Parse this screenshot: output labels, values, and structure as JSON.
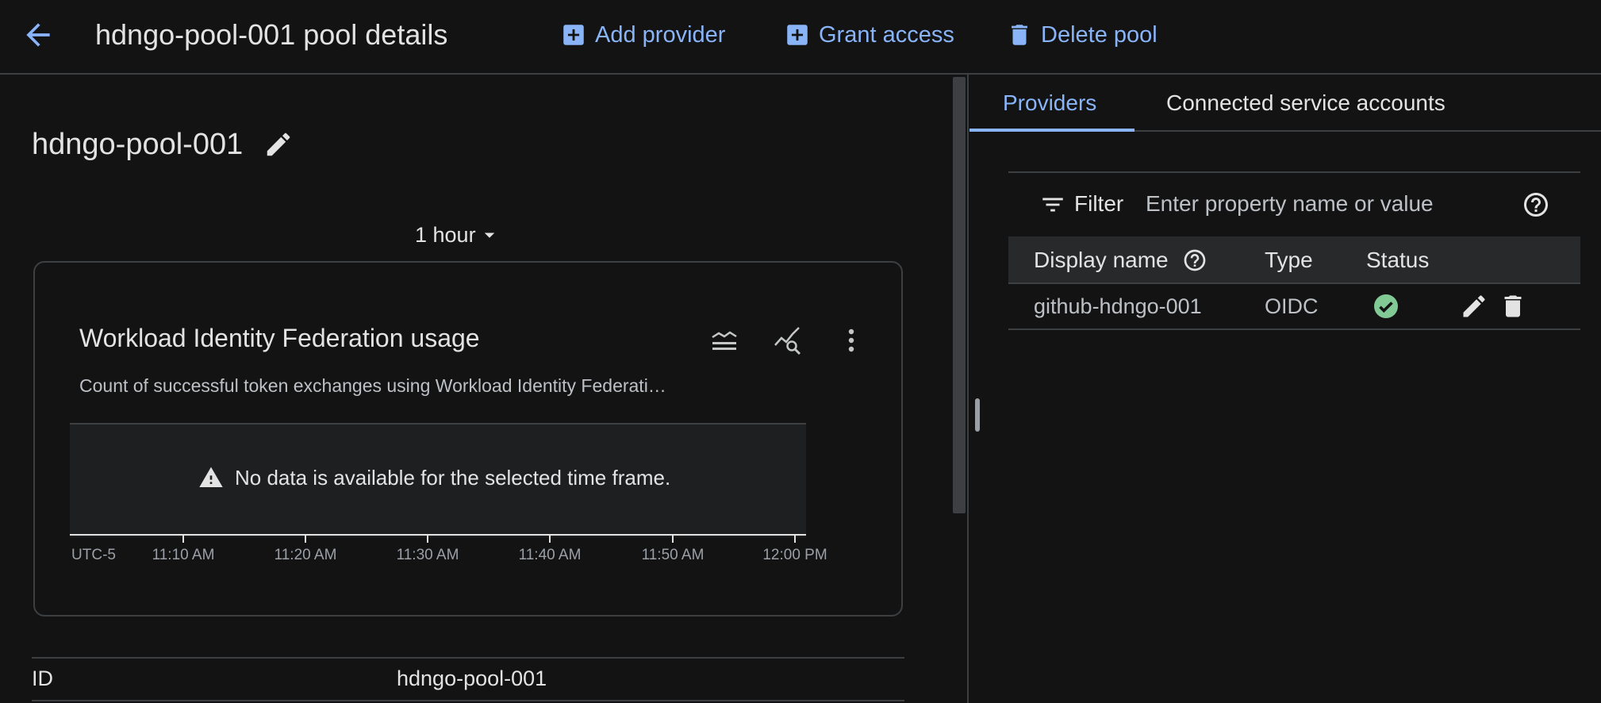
{
  "header": {
    "back_icon": "arrow-back-icon",
    "title": "hdngo-pool-001 pool details",
    "actions": [
      {
        "label": "Add provider",
        "icon": "add-box-icon"
      },
      {
        "label": "Grant access",
        "icon": "add-box-icon"
      },
      {
        "label": "Delete pool",
        "icon": "trash-icon"
      }
    ]
  },
  "pool": {
    "name": "hdngo-pool-001"
  },
  "time_range": {
    "selected": "1 hour"
  },
  "chart_card": {
    "title": "Workload Identity Federation usage",
    "subtitle": "Count of successful token exchanges using Workload Identity Federati…",
    "empty_message": "No data is available for the selected time frame.",
    "timezone": "UTC-5",
    "time_ticks": [
      "11:10 AM",
      "11:20 AM",
      "11:30 AM",
      "11:40 AM",
      "11:50 AM",
      "12:00 PM"
    ],
    "icons": [
      "legend-icon",
      "explore-chart-icon",
      "more-vert-icon"
    ]
  },
  "properties": [
    {
      "label": "ID",
      "value": "hdngo-pool-001"
    }
  ],
  "right_panel": {
    "tabs": [
      {
        "label": "Providers",
        "active": true
      },
      {
        "label": "Connected service accounts",
        "active": false
      }
    ],
    "filter": {
      "label": "Filter",
      "placeholder": "Enter property name or value"
    },
    "table": {
      "headers": [
        "Display name",
        "Type",
        "Status"
      ],
      "rows": [
        {
          "display_name": "github-hdngo-001",
          "type": "OIDC",
          "status": "ok"
        }
      ]
    }
  },
  "colors": {
    "background": "#131314",
    "accent": "#8ab4f8",
    "status_ok": "#81c995",
    "divider": "#3c4043"
  }
}
